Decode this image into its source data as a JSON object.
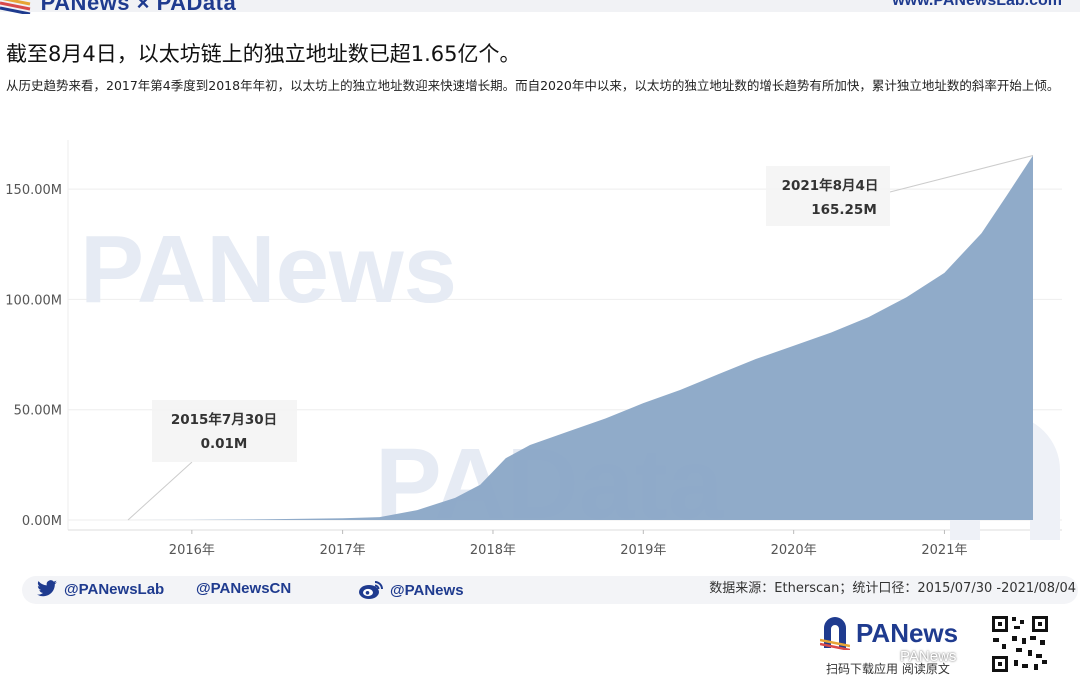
{
  "header": {
    "brand": "PANews × PAData",
    "url": "www.PANewsLab.com"
  },
  "title": "截至8月4日，以太坊链上的独立地址数已超1.65亿个。",
  "subtitle": "从历史趋势来看，2017年第4季度到2018年年初，以太坊上的独立地址数迎来快速增长期。而自2020年中以来，以太坊的独立地址数的增长趋势有所加快，累计独立地址数的斜率开始上倾。",
  "watermarks": [
    "PANews",
    "PAData"
  ],
  "chart_data": {
    "type": "area",
    "x_type": "date",
    "x_ticks": [
      "2016年",
      "2017年",
      "2018年",
      "2019年",
      "2020年",
      "2021年"
    ],
    "y_ticks": [
      "0.00M",
      "50.00M",
      "100.00M",
      "150.00M"
    ],
    "ylim": [
      0,
      170
    ],
    "xlim": [
      "2015-07-30",
      "2021-08-04"
    ],
    "y_unit": "M",
    "color": "#8aa6c6",
    "grid": true,
    "x": [
      "2015-07-30",
      "2016-01-01",
      "2016-07-01",
      "2017-01-01",
      "2017-04-01",
      "2017-07-01",
      "2017-10-01",
      "2017-12-01",
      "2018-01-01",
      "2018-02-01",
      "2018-04-01",
      "2018-07-01",
      "2018-10-01",
      "2019-01-01",
      "2019-04-01",
      "2019-07-01",
      "2019-10-01",
      "2020-01-01",
      "2020-04-01",
      "2020-07-01",
      "2020-10-01",
      "2021-01-01",
      "2021-04-01",
      "2021-06-01",
      "2021-08-04"
    ],
    "values": [
      0.01,
      0.05,
      0.3,
      0.8,
      1.3,
      4.5,
      10,
      16,
      22,
      28,
      34,
      40,
      46,
      53,
      59,
      66,
      73,
      79,
      85,
      92,
      101,
      112,
      130,
      147,
      165.25
    ],
    "annotations": [
      {
        "date": "2015年7月30日",
        "value": "0.01M",
        "x": "2015-07-30",
        "y": 0.01
      },
      {
        "date": "2021年8月4日",
        "value": "165.25M",
        "x": "2021-08-04",
        "y": 165.25
      }
    ]
  },
  "footer": {
    "twitter": "@PANewsLab",
    "twitter_cn": "@PANewsCN",
    "weibo": "@PANews",
    "source": "数据来源：Etherscan；统计口径：2015/07/30 -2021/08/04",
    "logo": "PANews",
    "scan_caption": "扫码下载应用  阅读原文",
    "wechat_watermark": "PANews"
  }
}
